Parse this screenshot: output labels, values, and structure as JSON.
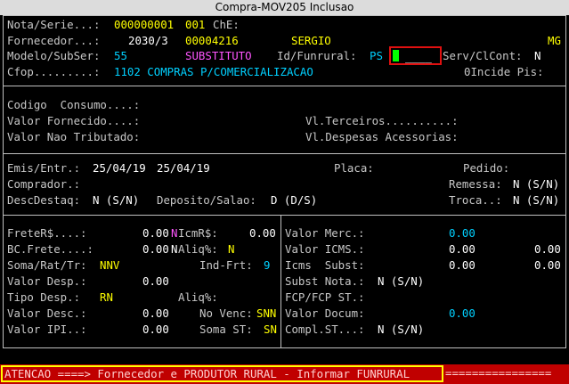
{
  "window": {
    "title": "Compra-MOV205  Inclusao"
  },
  "header": {
    "nota_label": "Nota/Serie...:",
    "nota_value": "000000001",
    "serie_value": "001",
    "chave_label": "ChE:",
    "fornecedor_label": "Fornecedor...:",
    "fornecedor_code": "2030/3",
    "fornecedor_num": "00004216",
    "fornecedor_name": "SERGIO",
    "fornecedor_uf": "MG",
    "modelo_label": "Modelo/SubSer:",
    "modelo_value": "55",
    "subser_value": "SUBSTITUTO",
    "funrural_label": "Id/Funrural:",
    "funrural_value": "PS",
    "funrural_input": "____",
    "servcl_label": "Serv/ClCont:",
    "servcl_value": "N",
    "cfop_label": "Cfop.........:",
    "cfop_value": "1102 COMPRAS P/COMERCIALIZACAO",
    "incide_label": "0Incide Pis:"
  },
  "middle": {
    "codigo_label": "Codigo  Consumo....:",
    "valor_fornecido_label": "Valor Fornecido....:",
    "vl_terceiros_label": "Vl.Terceiros..........:",
    "valor_nao_trib_label": "Valor Nao Tributado:",
    "vl_despesas_label": "Vl.Despesas Acessorias:"
  },
  "emissao": {
    "emis_label": "Emis/Entr.:",
    "emis_value": "25/04/19",
    "entr_value": "25/04/19",
    "placa_label": "Placa:",
    "pedido_label": "Pedido:",
    "comprador_label": "Comprador.:",
    "remessa_label": "Remessa:",
    "remessa_value": "N (S/N)",
    "descdestaq_label": "DescDestaq:",
    "descdestaq_value": "N (S/N)",
    "deposito_label": "Deposito/Salao:",
    "deposito_value": "D (D/S)",
    "troca_label": "Troca..:",
    "troca_value": "N (S/N)"
  },
  "values_left": {
    "frete_label": "FreteR$....:",
    "frete_value": "0.00",
    "nicmr_n": "N",
    "icmr_label": "IcmR$:",
    "icmr_value": "0.00",
    "bcfrete_label": "BC.Frete....:",
    "bcfrete_value": "0.00",
    "aliq_n": "N",
    "aliq_label": "Aliq%:",
    "aliq_value": "N",
    "soma_label": "Soma/Rat/Tr:",
    "soma_value": "NNV",
    "indfrt_label": "Ind-Frt:",
    "indfrt_value": "9",
    "despvalor_label": "Valor Desp.:",
    "despvalor_value": "0.00",
    "tipodesp_label": "Tipo Desp.:",
    "tipodesp_value": "RN",
    "aliq2_label": "Aliq%:",
    "desc_label": "Valor Desc.:",
    "desc_value": "0.00",
    "novenc_label": "No Venc:",
    "novenc_value": "SNN",
    "ipi_label": "Valor IPI..:",
    "ipi_value": "0.00",
    "somast_label": "Soma ST:",
    "somast_value": "SN"
  },
  "values_right": {
    "merc_label": "Valor Merc.:",
    "merc_value": "0.00",
    "icms_label": "Valor ICMS.:",
    "icms_value": "0.00",
    "icms_value2": "0.00",
    "icmsst_label": "Icms  Subst:",
    "icmsst_value": "0.00",
    "icmsst_value2": "0.00",
    "substnota_label": "Subst Nota.:",
    "substnota_value": "N (S/N)",
    "fcp_label": "FCP/FCP ST.:",
    "docum_label": "Valor Docum:",
    "docum_value": "0.00",
    "compl_label": "Compl.ST...:",
    "compl_value": "N (S/N)"
  },
  "status": {
    "message": "ATENCAO ====> Fornecedor e PRODUTOR RURAL - Informar FUNRURAL ",
    "tail": "================"
  },
  "colors": {
    "background": "#000000",
    "label": "#c8c8c8",
    "value_yellow": "#ffff00",
    "value_cyan": "#00d0ff",
    "value_magenta": "#ff55ff",
    "status_bar": "#c00000",
    "highlight_border": "#e01010",
    "cursor": "#00ff00"
  }
}
